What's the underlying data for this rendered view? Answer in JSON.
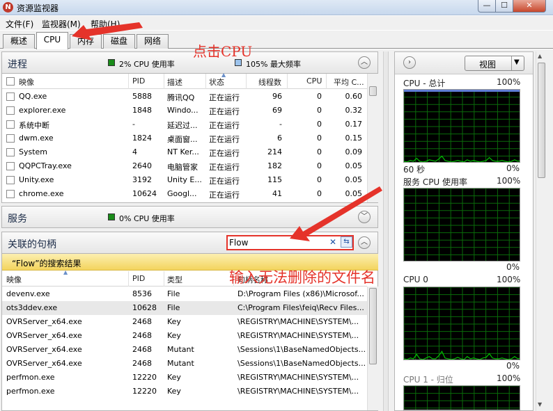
{
  "window": {
    "title": "资源监视器",
    "min": "—",
    "max": "☐",
    "close": "✕"
  },
  "menu": [
    "文件(F)",
    "监视器(M)",
    "帮助(H)"
  ],
  "tabs": [
    "概述",
    "CPU",
    "内存",
    "磁盘",
    "网络"
  ],
  "processes": {
    "title": "进程",
    "legend1": "2% CPU 使用率",
    "legend2": "105% 最大频率",
    "columns": [
      "映像",
      "PID",
      "描述",
      "状态",
      "线程数",
      "CPU",
      "平均 C..."
    ],
    "rows": [
      [
        "QQ.exe",
        "5888",
        "腾讯QQ",
        "正在运行",
        "96",
        "0",
        "0.60"
      ],
      [
        "explorer.exe",
        "1848",
        "Windo...",
        "正在运行",
        "69",
        "0",
        "0.32"
      ],
      [
        "系统中断",
        "-",
        "延迟过...",
        "正在运行",
        "-",
        "0",
        "0.17"
      ],
      [
        "dwm.exe",
        "1824",
        "桌面窗...",
        "正在运行",
        "6",
        "0",
        "0.15"
      ],
      [
        "System",
        "4",
        "NT Ker...",
        "正在运行",
        "214",
        "0",
        "0.09"
      ],
      [
        "QQPCTray.exe",
        "2640",
        "电脑管家",
        "正在运行",
        "182",
        "0",
        "0.05"
      ],
      [
        "Unity.exe",
        "3192",
        "Unity E...",
        "正在运行",
        "115",
        "0",
        "0.05"
      ],
      [
        "chrome.exe",
        "10624",
        "Googl...",
        "正在运行",
        "41",
        "0",
        "0.05"
      ]
    ]
  },
  "services": {
    "title": "服务",
    "legend": "0% CPU 使用率"
  },
  "handles": {
    "title": "关联的句柄",
    "search_value": "Flow",
    "result_banner": "“Flow”的搜索结果",
    "columns": [
      "映像",
      "PID",
      "类型",
      "句柄名称"
    ],
    "rows": [
      [
        "devenv.exe",
        "8536",
        "File",
        "D:\\Program Files (x86)\\Microsof..."
      ],
      [
        "ots3ddev.exe",
        "10628",
        "File",
        "C:\\Program Files\\feiq\\Recv Files..."
      ],
      [
        "OVRServer_x64.exe",
        "2468",
        "Key",
        "\\REGISTRY\\MACHINE\\SYSTEM\\..."
      ],
      [
        "OVRServer_x64.exe",
        "2468",
        "Key",
        "\\REGISTRY\\MACHINE\\SYSTEM\\..."
      ],
      [
        "OVRServer_x64.exe",
        "2468",
        "Mutant",
        "\\Sessions\\1\\BaseNamedObjects..."
      ],
      [
        "OVRServer_x64.exe",
        "2468",
        "Mutant",
        "\\Sessions\\1\\BaseNamedObjects..."
      ],
      [
        "perfmon.exe",
        "12220",
        "Key",
        "\\REGISTRY\\MACHINE\\SYSTEM\\..."
      ],
      [
        "perfmon.exe",
        "12220",
        "Key",
        "\\REGISTRY\\MACHINE\\SYSTEM\\..."
      ]
    ]
  },
  "right_pane": {
    "view_label": "视图",
    "graphs": [
      {
        "title": "CPU - 总计",
        "max": "100%",
        "footer_left": "60 秒",
        "footer_right": "0%"
      },
      {
        "title": "服务 CPU 使用率",
        "max": "100%",
        "footer_left": "",
        "footer_right": "0%"
      },
      {
        "title": "CPU 0",
        "max": "100%",
        "footer_left": "",
        "footer_right": "0%"
      },
      {
        "title": "CPU 1 - 归位",
        "max": "100%",
        "footer_left": "",
        "footer_right": ""
      }
    ]
  },
  "annotations": {
    "click_cpu": "点击CPU",
    "enter_name": "输入无法删除的文件名"
  },
  "colors": {
    "graph_line": "#00c000",
    "grid": "#0a6b0a",
    "banner": "#f7df6e",
    "annotation": "#e5332a"
  },
  "chart_data": [
    {
      "type": "line",
      "title": "CPU - 总计",
      "ylim": [
        0,
        100
      ],
      "series": [
        {
          "values": [
            2,
            1,
            3,
            2,
            6,
            2,
            1,
            2,
            4,
            3,
            2,
            5,
            9,
            3,
            2,
            1,
            2,
            3,
            2,
            1,
            4,
            2,
            3,
            2,
            1,
            2,
            3,
            7,
            3,
            2,
            2,
            3,
            2,
            1,
            2,
            4,
            2,
            3
          ]
        }
      ]
    },
    {
      "type": "line",
      "title": "服务 CPU 使用率",
      "ylim": [
        0,
        100
      ],
      "series": [
        {
          "values": [
            0,
            0,
            0,
            0,
            0,
            0,
            0,
            0,
            0,
            0,
            0,
            0,
            0,
            0,
            0,
            0,
            0,
            0,
            0,
            0,
            0,
            0,
            0,
            0,
            0,
            0,
            0,
            0,
            0,
            0,
            0,
            0,
            0,
            0,
            0,
            0,
            0,
            0
          ]
        }
      ]
    },
    {
      "type": "line",
      "title": "CPU 0",
      "ylim": [
        0,
        100
      ],
      "series": [
        {
          "values": [
            2,
            1,
            3,
            2,
            8,
            2,
            1,
            3,
            5,
            2,
            2,
            6,
            12,
            3,
            2,
            1,
            2,
            4,
            2,
            1,
            5,
            2,
            3,
            2,
            1,
            3,
            4,
            9,
            3,
            2,
            2,
            3,
            2,
            1,
            2,
            5,
            2,
            3
          ]
        }
      ]
    }
  ]
}
